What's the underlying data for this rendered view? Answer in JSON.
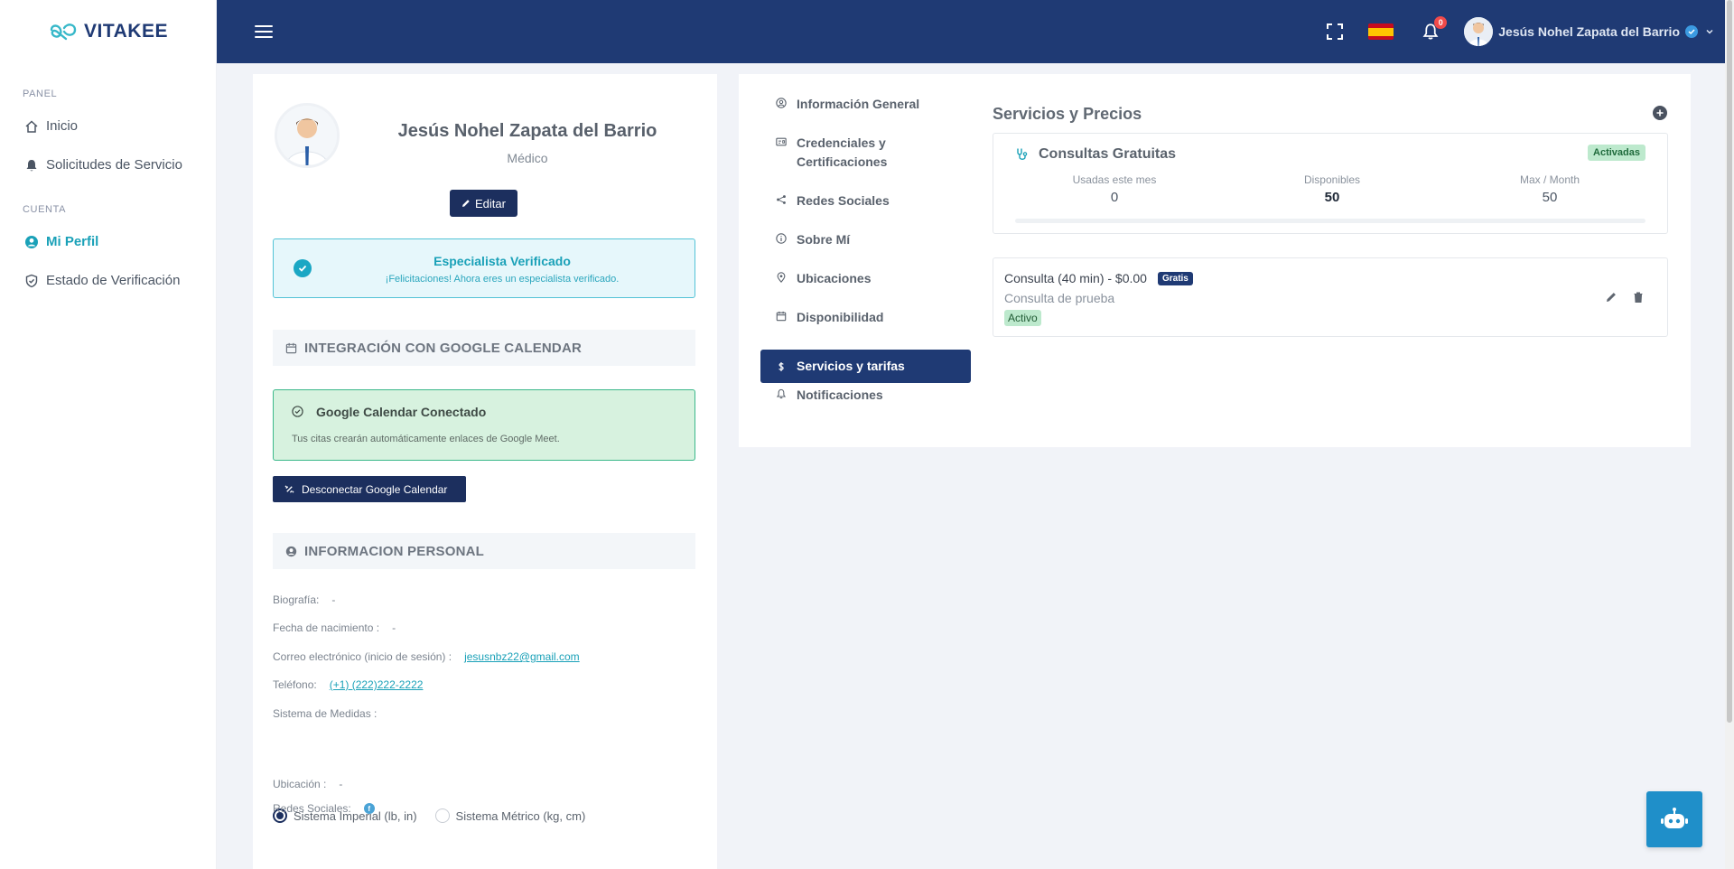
{
  "brand": {
    "name": "VITAKEE"
  },
  "sidebar": {
    "panel_title": "PANEL",
    "cuenta_title": "CUENTA",
    "items": [
      {
        "label": "Inicio",
        "icon": "home-icon"
      },
      {
        "label": "Solicitudes de Servicio",
        "icon": "bell-icon"
      },
      {
        "label": "Mi Perfil",
        "icon": "user-circle-icon",
        "active": true
      },
      {
        "label": "Estado de Verificación",
        "icon": "shield-check-icon"
      }
    ]
  },
  "topbar": {
    "notifications_count": "0",
    "user_name": "Jesús Nohel Zapata del Barrio"
  },
  "profile": {
    "name": "Jesús Nohel Zapata del Barrio",
    "role": "Médico",
    "edit_label": "Editar",
    "verified_title": "Especialista Verificado",
    "verified_text": "¡Felicitaciones! Ahora eres un especialista verificado.",
    "gcal_section": "INTEGRACIÓN CON GOOGLE CALENDAR",
    "gcal_title": "Google Calendar Conectado",
    "gcal_text": "Tus citas crearán automáticamente enlaces de Google Meet.",
    "gcal_disconnect": "Desconectar Google Calendar",
    "personal_section": "INFORMACION PERSONAL",
    "bio_label": "Biografía:",
    "bio_value": "-",
    "birth_label": "Fecha de nacimiento :",
    "birth_value": "-",
    "email_label": "Correo electrónico (inicio de sesión) :",
    "email_value": "jesusnbz22@gmail.com",
    "phone_label": "Teléfono:",
    "phone_value": "(+1) (222)222-2222",
    "measure_label": "Sistema de Medidas :",
    "measure_imperial": "Sistema Imperial (lb, in)",
    "measure_metric": "Sistema Métrico (kg, cm)",
    "measure_selected": "imperial",
    "location_label": "Ubicación :",
    "location_value": "-",
    "social_label": "Redes Sociales:"
  },
  "tabs": [
    {
      "label": "Información General",
      "icon": "user-circle-icon"
    },
    {
      "label": "Credenciales y Certificaciones",
      "icon": "id-card-icon"
    },
    {
      "label": "Redes Sociales",
      "icon": "share-icon"
    },
    {
      "label": "Sobre Mí",
      "icon": "info-icon"
    },
    {
      "label": "Ubicaciones",
      "icon": "map-pin-icon"
    },
    {
      "label": "Disponibilidad",
      "icon": "calendar-icon"
    },
    {
      "label": "Servicios y tarifas",
      "icon": "dollar-icon",
      "active": true
    },
    {
      "label": "Notificaciones",
      "icon": "bell-icon"
    }
  ],
  "services": {
    "title": "Servicios y Precios",
    "free": {
      "title": "Consultas Gratuitas",
      "status": "Activadas",
      "used_label": "Usadas este mes",
      "used_value": "0",
      "available_label": "Disponibles",
      "available_value": "50",
      "max_label": "Max / Month",
      "max_value": "50",
      "usage_fraction": 0
    },
    "item": {
      "name": "Consulta (40 min) - $0.00",
      "badge": "Gratis",
      "description": "Consulta de prueba",
      "status": "Activo"
    }
  },
  "colors": {
    "primary": "#1f3a74",
    "accent": "#1aa1b8",
    "success_bg": "#d7f2df",
    "info_bg": "#e6f7fb"
  }
}
